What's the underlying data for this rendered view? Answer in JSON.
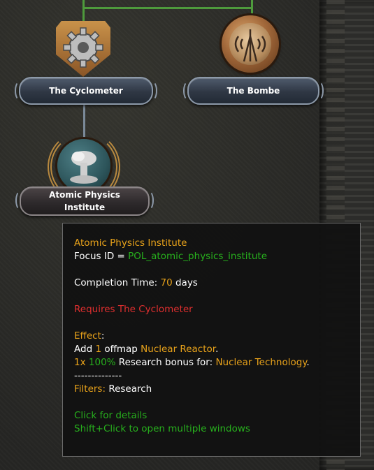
{
  "focus_tree": {
    "nodes": [
      {
        "label": "The Cyclometer",
        "icon": "gear-icon"
      },
      {
        "label": "The Bombe",
        "icon": "radio-tower-icon"
      },
      {
        "label": "Atomic Physics Institute",
        "icon": "mushroom-cloud-icon"
      }
    ]
  },
  "tooltip": {
    "title": "Atomic Physics Institute",
    "focus_id_label": "Focus ID = ",
    "focus_id": "POL_atomic_physics_institute",
    "completion_label": "Completion Time: ",
    "completion_value": "70",
    "completion_unit": " days",
    "requires": "Requires The Cyclometer",
    "effect_label": "Effect",
    "effect_colon": ":",
    "effect1_prefix": "Add ",
    "effect1_count": "1",
    "effect1_mid": " offmap ",
    "effect1_item": "Nuclear Reactor",
    "effect1_end": ".",
    "effect2_mult": "1x",
    "effect2_pct": "100%",
    "effect2_text": " Research bonus for: ",
    "effect2_target": "Nuclear Technology",
    "effect2_end": ".",
    "divider": "--------------",
    "filters_label": "Filters: ",
    "filters_value": "Research",
    "hint1": "Click for details",
    "hint2": "Shift+Click to open multiple windows"
  },
  "colors": {
    "highlight": "#e8a21a",
    "positive": "#27b01d",
    "negative": "#e02f2f",
    "connector": "#4e9a3c"
  }
}
